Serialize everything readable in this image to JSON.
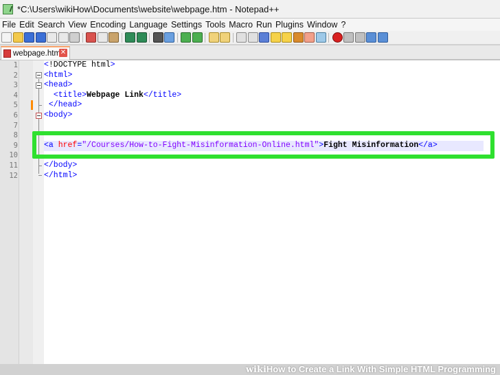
{
  "window": {
    "title": "*C:\\Users\\wikiHow\\Documents\\website\\webpage.htm - Notepad++",
    "icon": "notepad-plus-plus-icon"
  },
  "menu": [
    "File",
    "Edit",
    "Search",
    "View",
    "Encoding",
    "Language",
    "Settings",
    "Tools",
    "Macro",
    "Run",
    "Plugins",
    "Window",
    "?"
  ],
  "tab": {
    "label": "webpage.htm",
    "close_icon": "close-icon"
  },
  "editor": {
    "line_numbers": [
      "1",
      "2",
      "3",
      "4",
      "5",
      "6",
      "7",
      "8",
      "9",
      "10",
      "11",
      "12"
    ],
    "lines": {
      "l1": {
        "open": "<",
        "doctype": "!DOCTYPE html",
        "close": ">"
      },
      "l2": {
        "tag": "<html>"
      },
      "l3": {
        "tag": "<head>"
      },
      "l4": {
        "indent": "  ",
        "open": "<title>",
        "text": "Webpage Link",
        "close": "</title>"
      },
      "l5": {
        "indent": " ",
        "tag": "</head>"
      },
      "l6": {
        "tag": "<body>"
      },
      "l9": {
        "open": "<a ",
        "attr": "href",
        "eq": "=",
        "val": "\"/Courses/How-to-Fight-Misinformation-Online.html\"",
        "gt": ">",
        "text": "Fight Misinformation",
        "close": "</a>"
      },
      "l11": {
        "tag": "</body>"
      },
      "l12": {
        "tag": "</html>"
      }
    }
  },
  "caption": {
    "brand": "wiki",
    "how": "How",
    "rest": " to Create a Link With Simple HTML Programming"
  },
  "colors": {
    "tag": "#0000ff",
    "attribute": "#ff0000",
    "value": "#8000ff",
    "highlight": "#2fe02f",
    "change_marker": "#ff8a00"
  }
}
